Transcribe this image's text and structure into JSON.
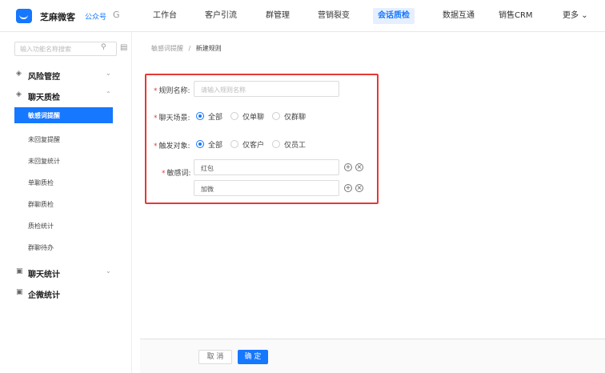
{
  "brand": {
    "name": "芝麻微客",
    "account": "公众号",
    "account_icon": "G"
  },
  "nav": {
    "items": [
      {
        "label": "工作台"
      },
      {
        "label": "客户引流"
      },
      {
        "label": "群管理"
      },
      {
        "label": "营销裂变"
      },
      {
        "label": "会话质检",
        "active": true
      },
      {
        "label": "数据互通"
      },
      {
        "label": "销售CRM"
      },
      {
        "label": "更多"
      }
    ],
    "more_arrow": "⌄"
  },
  "sidebar": {
    "search_placeholder": "输入功能名称搜索",
    "groups": [
      {
        "label": "风险管控",
        "arrow": "⌄"
      },
      {
        "label": "聊天质检",
        "arrow": "⌃"
      },
      {
        "label": "聊天统计",
        "arrow": "⌄"
      },
      {
        "label": "企微统计"
      }
    ],
    "items": [
      {
        "label": "敏感词提醒",
        "active": true
      },
      {
        "label": "未回复提醒"
      },
      {
        "label": "未回复统计"
      },
      {
        "label": "单聊质检"
      },
      {
        "label": "群聊质检"
      },
      {
        "label": "质检统计"
      },
      {
        "label": "群聊待办"
      }
    ]
  },
  "breadcrumb": {
    "parent": "敏感词提醒",
    "separator": "/",
    "current": "新建规则"
  },
  "form": {
    "rule_name": {
      "label": "规则名称:",
      "placeholder": "请输入规则名称"
    },
    "chat_scene": {
      "label": "聊天场景:",
      "options": [
        "全部",
        "仅单聊",
        "仅群聊"
      ],
      "selected": 0
    },
    "trigger_target": {
      "label": "触发对象:",
      "options": [
        "全部",
        "仅客户",
        "仅员工"
      ],
      "selected": 0
    },
    "sensitive_words": {
      "label": "敏感词:",
      "values": [
        "红包",
        "加微"
      ]
    }
  },
  "footer": {
    "cancel": "取 消",
    "confirm": "确 定"
  },
  "colors": {
    "accent": "#1677ff",
    "highlight_border": "#e53935"
  }
}
